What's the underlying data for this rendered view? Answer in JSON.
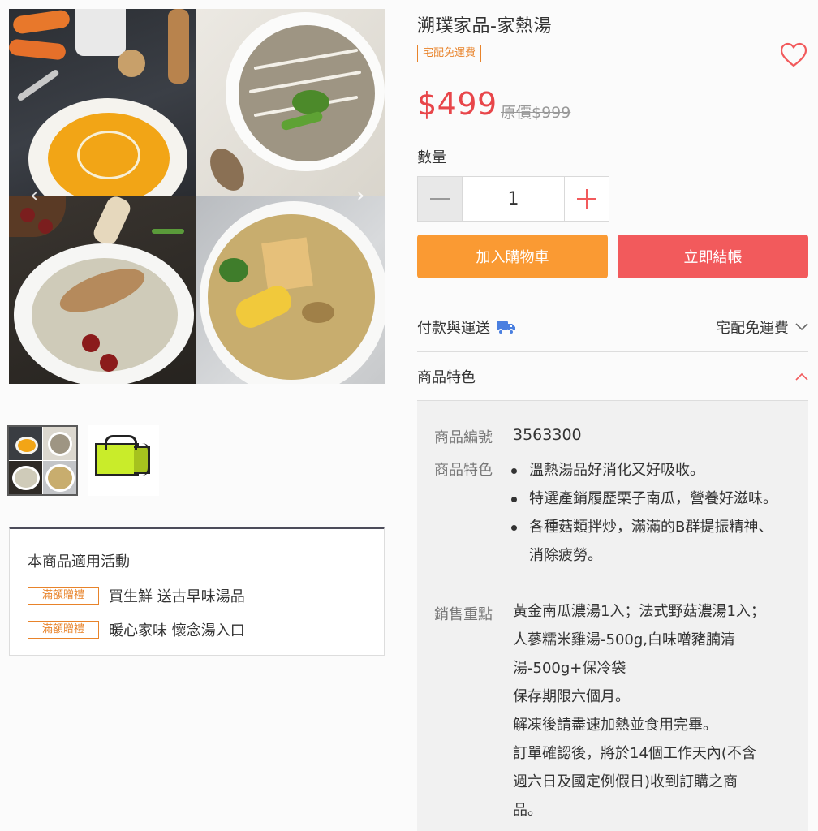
{
  "product": {
    "title": "溯璞家品-家熱湯",
    "shipping_tag": "宅配免運費",
    "price": "$499",
    "original_price": "原價$999",
    "quantity_label": "數量",
    "quantity_value": "1"
  },
  "buttons": {
    "add_to_cart": "加入購物車",
    "checkout": "立即結帳"
  },
  "payment_row": {
    "label": "付款與運送",
    "value": "宅配免運費"
  },
  "features_row": {
    "label": "商品特色"
  },
  "details": {
    "sku_label": "商品編號",
    "sku_value": "3563300",
    "features_label": "商品特色",
    "features": [
      "溫熱湯品好消化又好吸收。",
      "特選產銷履歷栗子南瓜，營養好滋味。",
      "各種菇類拌炒，滿滿的B群提振精神、消除疲勞。"
    ],
    "sales_label": "銷售重點",
    "sales_lines": [
      "黃金南瓜濃湯1入；法式野菇濃湯1入；",
      "人蔘糯米雞湯-500g,白味噌豬腩清",
      "湯-500g+保冷袋",
      "保存期限六個月。",
      "解凍後請盡速加熱並食用完畢。",
      "訂單確認後，將於14個工作天內(不含",
      "週六日及國定例假日)收到訂購之商",
      "品。"
    ]
  },
  "promotions": {
    "title": "本商品適用活動",
    "items": [
      {
        "tag": "滿額贈禮",
        "text": "買生鮮 送古早味湯品"
      },
      {
        "tag": "滿額贈禮",
        "text": "暖心家味 懷念湯入口"
      }
    ]
  },
  "colors": {
    "price": "#e8464a",
    "orange_tag": "#e8832a",
    "cart_button": "#fa9a33",
    "checkout_button": "#f25a5c",
    "truck_icon": "#4a7fe0"
  },
  "icons": {
    "favorite": "heart-icon",
    "minus": "minus-icon",
    "plus": "plus-icon",
    "shipping": "truck-icon",
    "expand": "chevron-down-icon",
    "collapse": "chevron-up-icon",
    "gallery_prev": "chevron-left-icon",
    "gallery_next": "chevron-right-icon"
  }
}
